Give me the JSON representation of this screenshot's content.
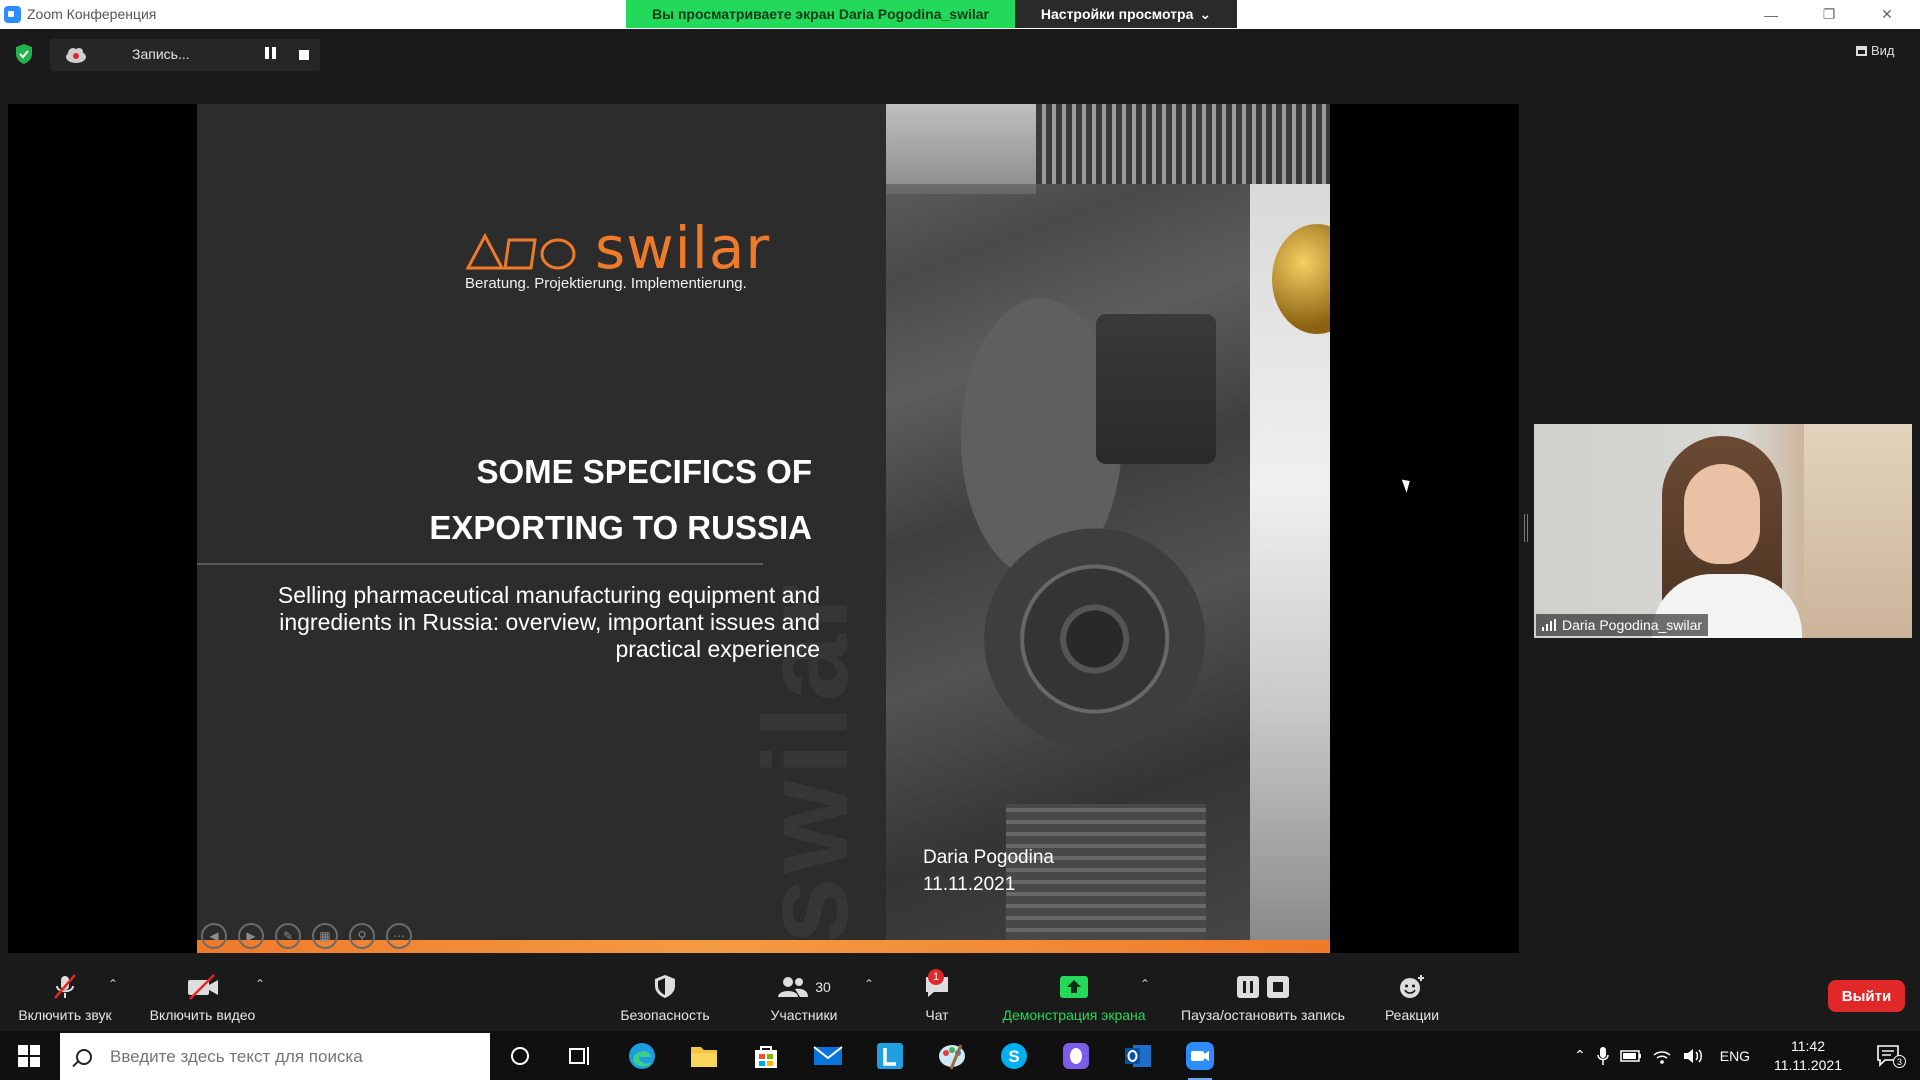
{
  "window": {
    "app_title": "Zoom Конференция",
    "share_banner": "Вы просматриваете экран Daria Pogodina_swilar",
    "view_settings": "Настройки просмотра",
    "view_button": "Вид"
  },
  "recording": {
    "label": "Запись..."
  },
  "slide": {
    "logo_word": "swilar",
    "tagline": "Beratung. Projektierung. Implementierung.",
    "title_line1": "SOME SPECIFICS OF",
    "title_line2": "EXPORTING TO RUSSIA",
    "subtitle": "Selling pharmaceutical manufacturing equipment and ingredients in Russia: overview, important issues and practical experience",
    "author": "Daria Pogodina",
    "date": "11.11.2021",
    "watermark": "swilar"
  },
  "participant": {
    "name": "Daria Pogodina_swilar"
  },
  "toolbar": {
    "unmute": "Включить звук",
    "start_video": "Включить видео",
    "security": "Безопасность",
    "participants": "Участники",
    "participants_count": "30",
    "chat": "Чат",
    "chat_badge": "1",
    "share_screen": "Демонстрация экрана",
    "pause_stop_recording": "Пауза/остановить запись",
    "reactions": "Реакции",
    "leave": "Выйти"
  },
  "taskbar": {
    "search_placeholder": "Введите здесь текст для поиска",
    "language": "ENG",
    "time": "11:42",
    "date": "11.11.2021",
    "notifications_count": "3"
  },
  "colors": {
    "share_green": "#23d959",
    "brand_orange": "#ee7a2a",
    "leave_red": "#e02828",
    "zoom_blue": "#2d8cff"
  }
}
